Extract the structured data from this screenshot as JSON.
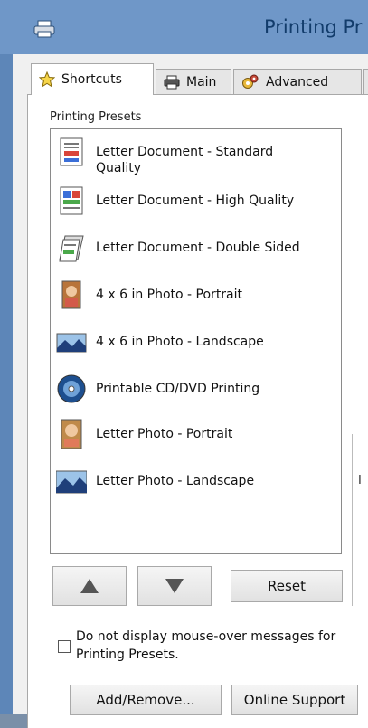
{
  "window": {
    "title": "Printing Pr",
    "title_icon": "printer-icon",
    "accent": "#6f97c8"
  },
  "tabs": [
    {
      "label": "Shortcuts",
      "icon": "star-icon",
      "active": true
    },
    {
      "label": "Main",
      "icon": "printer-icon",
      "active": false
    },
    {
      "label": "Advanced",
      "icon": "gears-icon",
      "active": false
    },
    {
      "label": "",
      "icon": "",
      "active": false
    }
  ],
  "presets": {
    "label": "Printing Presets",
    "items": [
      {
        "label": "Letter Document - Standard Quality",
        "icon": "document-standard-icon"
      },
      {
        "label": "Letter Document - High Quality",
        "icon": "document-high-quality-icon"
      },
      {
        "label": "Letter Document - Double Sided",
        "icon": "document-double-sided-icon"
      },
      {
        "label": "4 x 6 in Photo - Portrait",
        "icon": "photo-portrait-icon"
      },
      {
        "label": "4 x 6 in Photo - Landscape",
        "icon": "photo-landscape-icon"
      },
      {
        "label": "Printable CD/DVD Printing",
        "icon": "cd-dvd-icon"
      },
      {
        "label": "Letter Photo - Portrait",
        "icon": "photo-portrait-icon"
      },
      {
        "label": "Letter Photo - Landscape",
        "icon": "photo-landscape-icon"
      }
    ]
  },
  "buttons": {
    "up_icon": "up-arrow-icon",
    "down_icon": "down-arrow-icon",
    "reset": "Reset",
    "add_remove": "Add/Remove...",
    "online_support": "Online Support"
  },
  "mouseover_checkbox": {
    "label": "Do not display mouse-over messages for Printing Presets.",
    "checked": false
  },
  "right_panel": {
    "partial_char": "I"
  }
}
